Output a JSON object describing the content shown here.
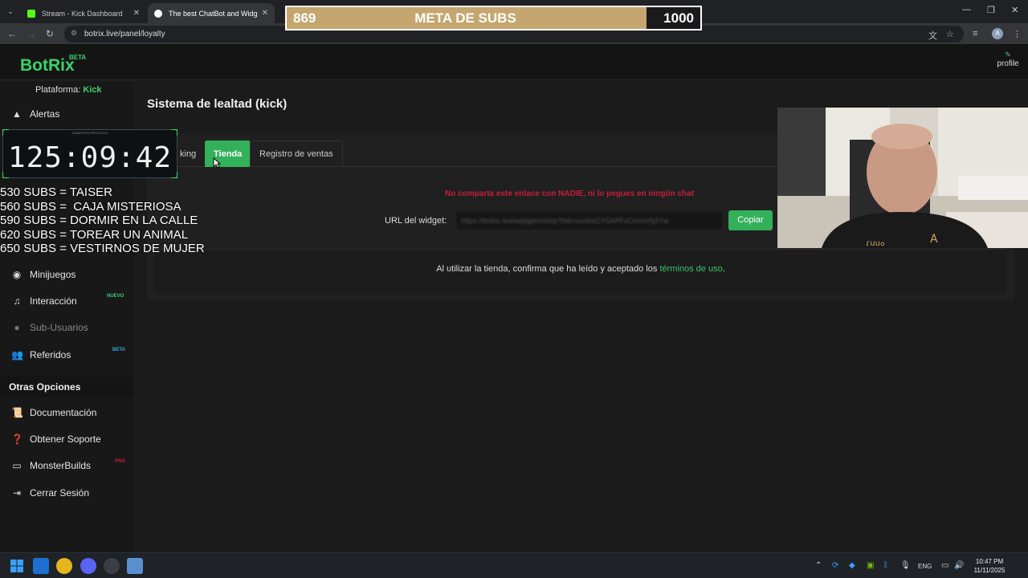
{
  "browser": {
    "tabs": [
      {
        "title": "Stream - Kick Dashboard",
        "favicon": "kick-icon",
        "color": "#53fc18"
      },
      {
        "title": "The best ChatBot and Widgets",
        "favicon": "botrix-icon",
        "color": "#ffffff"
      }
    ],
    "url": "botrix.live/panel/loyalty"
  },
  "goal_overlay": {
    "current": "869",
    "title": "META DE SUBS",
    "target": "1000",
    "progress": 0.869,
    "fill_color": "#c5a66e"
  },
  "app": {
    "logo": "BotRix",
    "logo_badge": "BETA",
    "profile_label": "profile",
    "accent": "#39d36a"
  },
  "sidebar": {
    "platform_label": "Plataforma:",
    "platform_value": "Kick",
    "items": [
      {
        "label": "Alertas",
        "icon": "warning-icon"
      },
      {
        "label": "Minijuegos",
        "icon": "gamepad-icon"
      },
      {
        "label": "Interacción",
        "icon": "music-icon",
        "badge": "NUEVO"
      },
      {
        "label": "Sub-Usuarios",
        "icon": "users-icon"
      },
      {
        "label": "Referidos",
        "icon": "user-group-icon",
        "badge": "BETA"
      }
    ],
    "section_title": "Otras Opciones",
    "other_items": [
      {
        "label": "Documentación",
        "icon": "scroll-icon"
      },
      {
        "label": "Obtener Soporte",
        "icon": "question-icon"
      },
      {
        "label": "MonsterBuilds",
        "icon": "desktop-icon",
        "badge": "PRO"
      },
      {
        "label": "Cerrar Sesión",
        "icon": "sign-out-icon"
      }
    ]
  },
  "timer_overlay": {
    "label": "SUBATHON PROTOCOL",
    "value": "125:09:42"
  },
  "subs_list": [
    "530 SUBS = TAISER",
    "560 SUBS =  CAJA MISTERIOSA",
    "590 SUBS = DORMIR EN LA CALLE",
    "620 SUBS = TOREAR UN ANIMAL",
    "650 SUBS = VESTIRNOS DE MUJER"
  ],
  "main": {
    "title": "Sistema de lealtad (kick)",
    "tabs": [
      {
        "label": "king",
        "active": false
      },
      {
        "label": "Tienda",
        "active": true
      },
      {
        "label": "Registro de ventas",
        "active": false
      }
    ],
    "warning": "No comparta este enlace con NADIE, ni lo pegues en ningún chat",
    "widget_label": "URL del widget:",
    "widget_value": "https://botrix.live/widgets/shop?bid=uuo6xi1YGkPFuCrnmrAj2Yw",
    "copy_label": "Copiar",
    "terms_prefix": "Al utilizar la tienda, confirma que ha leído y aceptado los ",
    "terms_link": "términos de uso",
    "terms_suffix": "."
  },
  "taskbar": {
    "lang": "ENG",
    "time": "10:47 PM",
    "date": "11/11/2025"
  }
}
